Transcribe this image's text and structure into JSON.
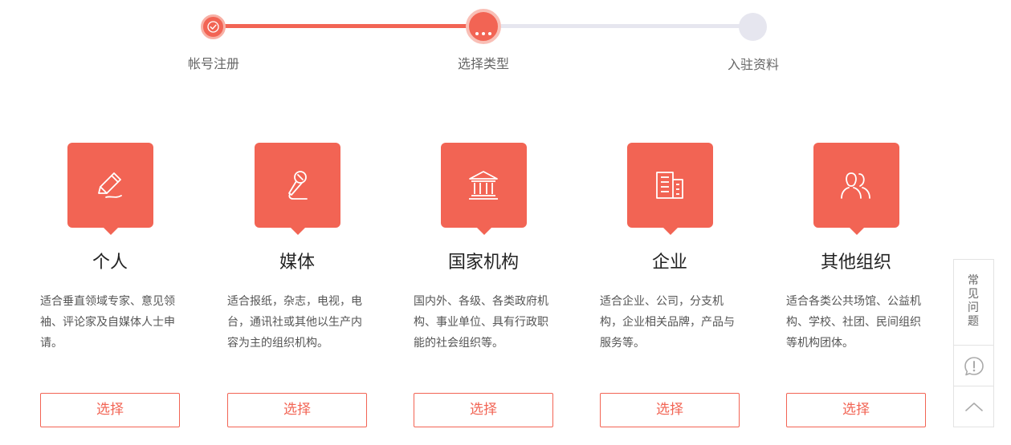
{
  "steps": [
    {
      "label": "帐号注册",
      "state": "done"
    },
    {
      "label": "选择类型",
      "state": "active"
    },
    {
      "label": "入驻资料",
      "state": "pending"
    }
  ],
  "cards": [
    {
      "title": "个人",
      "desc": "适合垂直领域专家、意见领袖、评论家及自媒体人士申请。",
      "button": "选择",
      "icon": "pen-icon"
    },
    {
      "title": "媒体",
      "desc": "适合报纸，杂志，电视，电台，通讯社或其他以生产内容为主的组织机构。",
      "button": "选择",
      "icon": "microphone-icon"
    },
    {
      "title": "国家机构",
      "desc": "国内外、各级、各类政府机构、事业单位、具有行政职能的社会组织等。",
      "button": "选择",
      "icon": "government-building-icon"
    },
    {
      "title": "企业",
      "desc": "适合企业、公司，分支机构，企业相关品牌，产品与服务等。",
      "button": "选择",
      "icon": "office-building-icon"
    },
    {
      "title": "其他组织",
      "desc": "适合各类公共场馆、公益机构、学校、社团、民间组织等机构团体。",
      "button": "选择",
      "icon": "group-icon"
    }
  ],
  "side_panel": {
    "faq_label": "常见问题",
    "feedback_icon": "feedback-icon",
    "back_to_top_icon": "chevron-up-icon"
  },
  "colors": {
    "accent": "#f26454",
    "inactive": "#e6e6ef"
  }
}
